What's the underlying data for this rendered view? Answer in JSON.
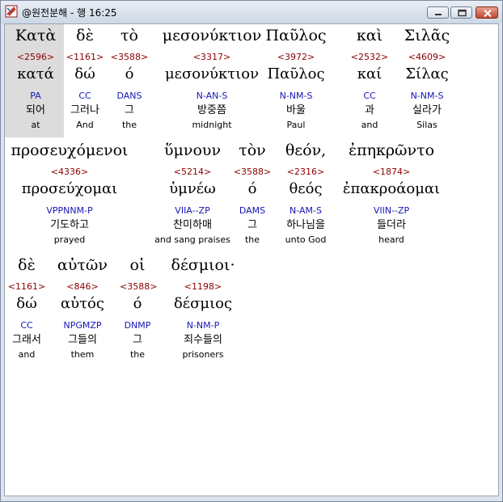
{
  "window": {
    "title": "@원전분해 - 행 16:25"
  },
  "rows": [
    {
      "words": [
        {
          "greek": "Κατὰ",
          "strongs": "<2596>",
          "lemma": "κατά",
          "morph": "PA",
          "korean": "되어",
          "english": "at"
        },
        {
          "greek": "δὲ",
          "strongs": "<1161>",
          "lemma": "δώ",
          "morph": "CC",
          "korean": "그러나",
          "english": "And"
        },
        {
          "greek": "τὸ",
          "strongs": "<3588>",
          "lemma": "ό",
          "morph": "DANS",
          "korean": "그",
          "english": "the"
        },
        {
          "greek": "μεσονύκτιον",
          "strongs": "<3317>",
          "lemma": "μεσονύκτιον",
          "morph": "N-AN-S",
          "korean": "방중쯤",
          "english": "midnight"
        },
        {
          "greek": "Παῦλος",
          "strongs": "<3972>",
          "lemma": "Παῦλος",
          "morph": "N-NM-S",
          "korean": "바울",
          "english": "Paul"
        },
        {
          "greek": "καὶ",
          "strongs": "<2532>",
          "lemma": "καί",
          "morph": "CC",
          "korean": "과",
          "english": "and"
        },
        {
          "greek": "Σιλᾶς",
          "strongs": "<4609>",
          "lemma": "Σίλας",
          "morph": "N-NM-S",
          "korean": "실라가",
          "english": "Silas"
        }
      ]
    },
    {
      "words": [
        {
          "greek": "προσευχόμενοι",
          "strongs": "<4336>",
          "lemma": "προσεύχομαι",
          "morph": "VPPNNM-P",
          "korean": "기도하고",
          "english": "prayed"
        },
        {
          "greek": "ὕμνουν",
          "strongs": "<5214>",
          "lemma": "ὑμνέω",
          "morph": "VIIA--ZP",
          "korean": "찬미하매",
          "english": "and sang praises"
        },
        {
          "greek": "τὸν",
          "strongs": "<3588>",
          "lemma": "ό",
          "morph": "DAMS",
          "korean": "그",
          "english": "the"
        },
        {
          "greek": "θεόν,",
          "strongs": "<2316>",
          "lemma": "θεός",
          "morph": "N-AM-S",
          "korean": "하나님을",
          "english": "unto God"
        },
        {
          "greek": "ἐπηκρῶντο",
          "strongs": "<1874>",
          "lemma": "ἐπακροάομαι",
          "morph": "VIIN--ZP",
          "korean": "들더라",
          "english": "heard"
        }
      ]
    },
    {
      "words": [
        {
          "greek": "δὲ",
          "strongs": "<1161>",
          "lemma": "δώ",
          "morph": "CC",
          "korean": "그래서",
          "english": "and"
        },
        {
          "greek": "αὐτῶν",
          "strongs": "<846>",
          "lemma": "αὐτός",
          "morph": "NPGMZP",
          "korean": "그들의",
          "english": "them"
        },
        {
          "greek": "οἱ",
          "strongs": "<3588>",
          "lemma": "ό",
          "morph": "DNMP",
          "korean": "그",
          "english": "the"
        },
        {
          "greek": "δέσμιοι·",
          "strongs": "<1198>",
          "lemma": "δέσμιος",
          "morph": "N-NM-P",
          "korean": "죄수들의",
          "english": "prisoners"
        }
      ]
    }
  ]
}
